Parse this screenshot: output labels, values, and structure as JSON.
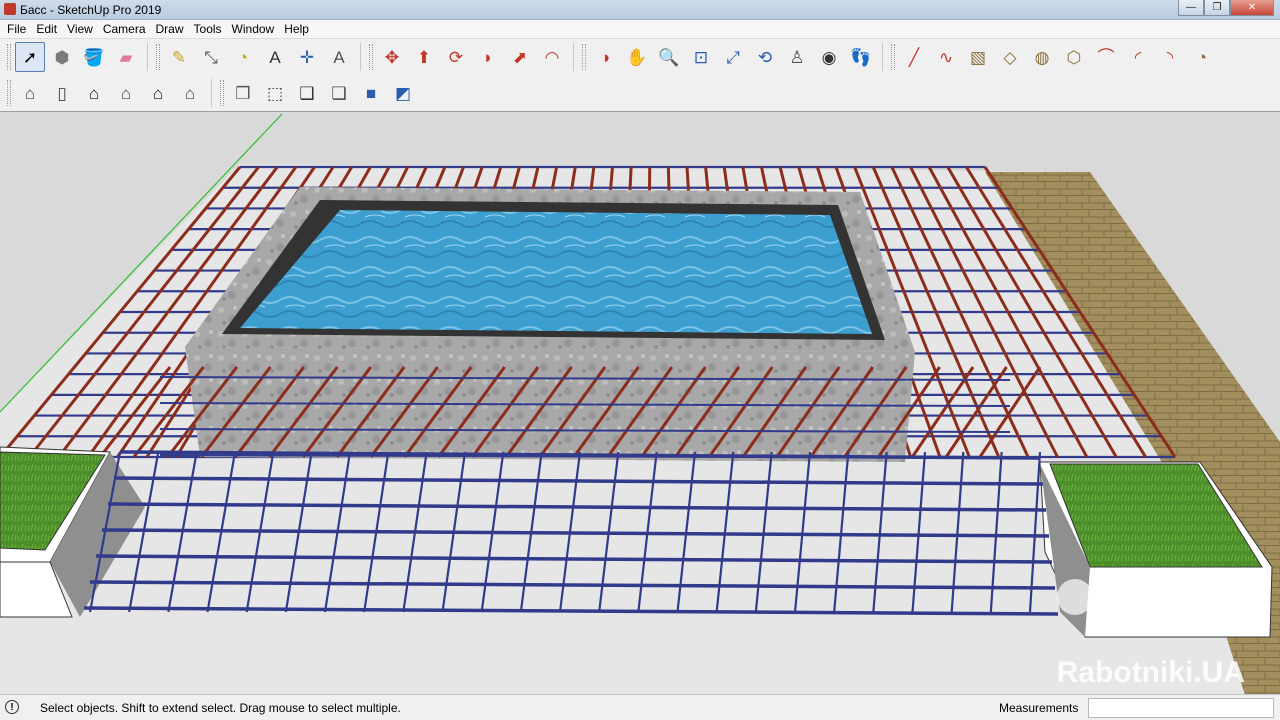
{
  "window": {
    "title": "Басс - SketchUp Pro 2019",
    "minimize_glyph": "—",
    "maximize_glyph": "❐",
    "close_glyph": "✕"
  },
  "menu": [
    {
      "id": "file",
      "label": "File"
    },
    {
      "id": "edit",
      "label": "Edit"
    },
    {
      "id": "view",
      "label": "View"
    },
    {
      "id": "camera",
      "label": "Camera"
    },
    {
      "id": "draw",
      "label": "Draw"
    },
    {
      "id": "tools",
      "label": "Tools"
    },
    {
      "id": "window",
      "label": "Window"
    },
    {
      "id": "help",
      "label": "Help"
    }
  ],
  "toolbar1": {
    "groups": [
      [
        {
          "name": "select-tool-icon",
          "glyph": "➚",
          "color": "#000000",
          "active": true
        },
        {
          "name": "make-component-icon",
          "glyph": "⬢",
          "color": "#7a7a7a"
        },
        {
          "name": "paint-bucket-icon",
          "glyph": "🪣",
          "color": "#c9a227"
        },
        {
          "name": "eraser-icon",
          "glyph": "▰",
          "color": "#e07a9a"
        }
      ],
      [
        {
          "name": "tape-measure-icon",
          "glyph": "✎",
          "color": "#c9a227"
        },
        {
          "name": "dimension-icon",
          "glyph": "⤡",
          "color": "#555555"
        },
        {
          "name": "protractor-icon",
          "glyph": "◔",
          "color": "#c9a227"
        },
        {
          "name": "text-tool-icon",
          "glyph": "A",
          "color": "#333333"
        },
        {
          "name": "axes-tool-icon",
          "glyph": "✛",
          "color": "#2a5db0"
        },
        {
          "name": "3d-text-icon",
          "glyph": "A",
          "color": "#555555"
        }
      ],
      [
        {
          "name": "move-tool-icon",
          "glyph": "✥",
          "color": "#c0392b"
        },
        {
          "name": "push-pull-icon",
          "glyph": "⬆",
          "color": "#c0392b"
        },
        {
          "name": "rotate-tool-icon",
          "glyph": "⟳",
          "color": "#c0392b"
        },
        {
          "name": "follow-me-icon",
          "glyph": "◗",
          "color": "#c0392b"
        },
        {
          "name": "scale-tool-icon",
          "glyph": "⬈",
          "color": "#c0392b"
        },
        {
          "name": "offset-tool-icon",
          "glyph": "◠",
          "color": "#c0392b"
        }
      ],
      [
        {
          "name": "orbit-icon",
          "glyph": "◑",
          "color": "#c0392b"
        },
        {
          "name": "pan-icon",
          "glyph": "✋",
          "color": "#c9a227"
        },
        {
          "name": "zoom-icon",
          "glyph": "🔍",
          "color": "#2a5db0"
        },
        {
          "name": "zoom-window-icon",
          "glyph": "⊡",
          "color": "#2a5db0"
        },
        {
          "name": "zoom-extents-icon",
          "glyph": "⤢",
          "color": "#2a5db0"
        },
        {
          "name": "previous-view-icon",
          "glyph": "⟲",
          "color": "#2a5db0"
        },
        {
          "name": "position-camera-icon",
          "glyph": "♙",
          "color": "#555555"
        },
        {
          "name": "look-around-icon",
          "glyph": "◉",
          "color": "#333333"
        },
        {
          "name": "walk-icon",
          "glyph": "👣",
          "color": "#333333"
        }
      ],
      [
        {
          "name": "line-tool-icon",
          "glyph": "╱",
          "color": "#c0392b"
        },
        {
          "name": "freehand-icon",
          "glyph": "∿",
          "color": "#c0392b"
        },
        {
          "name": "rectangle-icon",
          "glyph": "▧",
          "color": "#8a6d3b"
        },
        {
          "name": "rotated-rectangle-icon",
          "glyph": "◇",
          "color": "#8a6d3b"
        },
        {
          "name": "circle-icon",
          "glyph": "◍",
          "color": "#8a6d3b"
        },
        {
          "name": "polygon-icon",
          "glyph": "⬡",
          "color": "#8a6d3b"
        },
        {
          "name": "arc-icon",
          "glyph": "⌒",
          "color": "#c0392b"
        },
        {
          "name": "two-point-arc-icon",
          "glyph": "◜",
          "color": "#c0392b"
        },
        {
          "name": "three-point-arc-icon",
          "glyph": "◝",
          "color": "#c0392b"
        },
        {
          "name": "pie-icon",
          "glyph": "◔",
          "color": "#8a6d3b"
        }
      ]
    ]
  },
  "toolbar2": {
    "groups": [
      [
        {
          "name": "iso-view-icon",
          "glyph": "⌂",
          "color": "#444444"
        },
        {
          "name": "top-view-icon",
          "glyph": "▯",
          "color": "#444444"
        },
        {
          "name": "front-view-icon",
          "glyph": "⌂",
          "color": "#111111"
        },
        {
          "name": "right-view-icon",
          "glyph": "⌂",
          "color": "#444444"
        },
        {
          "name": "back-view-icon",
          "glyph": "⌂",
          "color": "#111111"
        },
        {
          "name": "left-view-icon",
          "glyph": "⌂",
          "color": "#444444"
        }
      ],
      [
        {
          "name": "xray-style-icon",
          "glyph": "❒",
          "color": "#555555"
        },
        {
          "name": "wireframe-style-icon",
          "glyph": "⬚",
          "color": "#333333"
        },
        {
          "name": "hidden-line-style-icon",
          "glyph": "❑",
          "color": "#333333"
        },
        {
          "name": "shaded-style-icon",
          "glyph": "❏",
          "color": "#444444"
        },
        {
          "name": "shaded-textures-style-icon",
          "glyph": "■",
          "color": "#2a5db0"
        },
        {
          "name": "monochrome-style-icon",
          "glyph": "◩",
          "color": "#2a5db0"
        }
      ]
    ]
  },
  "scene": {
    "watermark": "Rabotniki.UA",
    "colors": {
      "background": "#d9d9d9",
      "ground": "#e6e6e6",
      "rebar_red": "#8c2d1c",
      "rebar_blue": "#323a8c",
      "water": "#3d9fd0",
      "concrete": "#a9a9a9",
      "grass": "#4c8f2a",
      "paving": "#a38f5e",
      "axis_green": "#2fbf2f"
    }
  },
  "status": {
    "hint": "Select objects. Shift to extend select. Drag mouse to select multiple.",
    "measurements_label": "Measurements",
    "measurements_value": ""
  }
}
